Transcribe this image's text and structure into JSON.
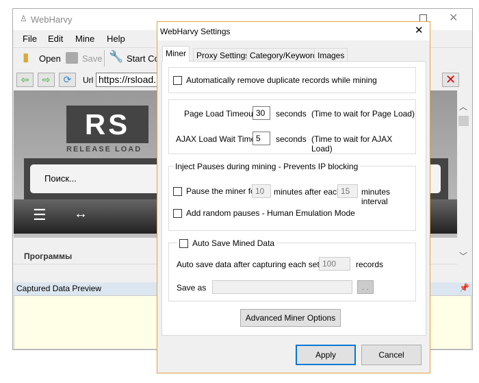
{
  "main": {
    "title": "WebHarvy",
    "menu": [
      "File",
      "Edit",
      "Mine",
      "Help"
    ],
    "toolbar": {
      "open": "Open",
      "save": "Save",
      "start": "Start Co"
    },
    "url_label": "Url",
    "url": "https://rsload.n",
    "web": {
      "logo": "RS",
      "logo_sub": "RELEASE LOAD",
      "search_placeholder": "Поиск...",
      "section": "Программы"
    },
    "preview_title": "Captured Data Preview"
  },
  "dialog": {
    "title": "WebHarvy Settings",
    "tabs": [
      "Miner",
      "Proxy Settings",
      "Category/Keyword",
      "Images"
    ],
    "remove_duplicates": "Automatically remove duplicate records while mining",
    "page_load_label": "Page Load Timeout",
    "page_load_value": "30",
    "seconds": "seconds",
    "page_load_hint": "(Time to wait for Page Load)",
    "ajax_label": "AJAX Load Wait Time",
    "ajax_value": "5",
    "ajax_hint": "(Time to wait for AJAX Load)",
    "pauses_title": "Inject Pauses during mining - Prevents IP blocking",
    "pause_label": "Pause the miner for",
    "pause_minutes": "10",
    "after_each": "minutes after each",
    "interval_minutes": "15",
    "interval_label": "minutes interval",
    "random_pauses": "Add random pauses - Human Emulation Mode",
    "autosave_title": "Auto Save Mined Data",
    "autosave_label": "Auto save data after capturing each set of",
    "autosave_count": "100",
    "records": "records",
    "save_as": "Save as",
    "save_as_value": "",
    "browse": ". .",
    "advanced": "Advanced Miner Options",
    "apply": "Apply",
    "cancel": "Cancel"
  }
}
